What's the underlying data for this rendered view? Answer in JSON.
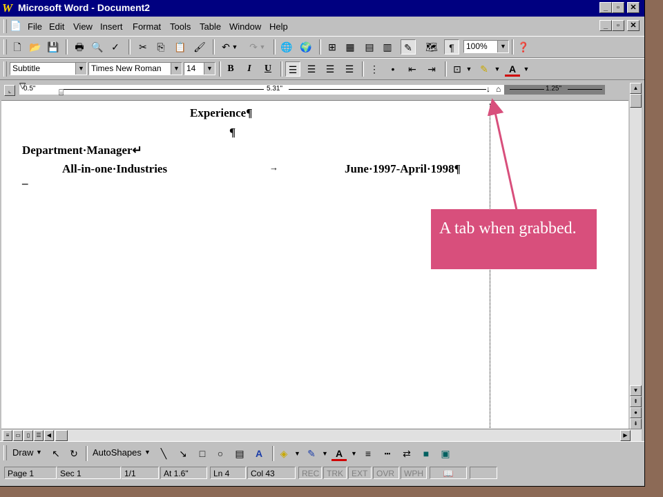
{
  "window": {
    "title": "Microsoft Word - Document2",
    "app_icon": "W",
    "caption_buttons": {
      "minimize": "_",
      "restore": "▫",
      "close": "✕"
    }
  },
  "menubar": {
    "items": [
      "File",
      "Edit",
      "View",
      "Insert",
      "Format",
      "Tools",
      "Table",
      "Window",
      "Help"
    ]
  },
  "standard_toolbar": {
    "zoom": "100%"
  },
  "formatting_toolbar": {
    "style": "Subtitle",
    "font": "Times New Roman",
    "size": "14",
    "bold": "B",
    "italic": "I",
    "underline": "U"
  },
  "ruler": {
    "left_measure": "0.5\"",
    "middle_measure": "5.31\"",
    "right_measure": "1.25\""
  },
  "document": {
    "heading": "Experience¶",
    "blank_para": "¶",
    "job_title": "Department·Manager↵",
    "company": "All-in-one·Industries",
    "tab_arrow": "→",
    "dates": "June·1997-April·1998¶",
    "cursor": "_"
  },
  "callout": {
    "text": "A tab when grabbed.",
    "color": "#d84f7c"
  },
  "drawing_toolbar": {
    "draw": "Draw",
    "autoshapes": "AutoShapes"
  },
  "statusbar": {
    "page": "Page 1",
    "sec": "Sec 1",
    "pages": "1/1",
    "at": "At 1.6\"",
    "ln": "Ln 4",
    "col": "Col 43",
    "rec": "REC",
    "trk": "TRK",
    "ext": "EXT",
    "ovr": "OVR",
    "wph": "WPH"
  }
}
